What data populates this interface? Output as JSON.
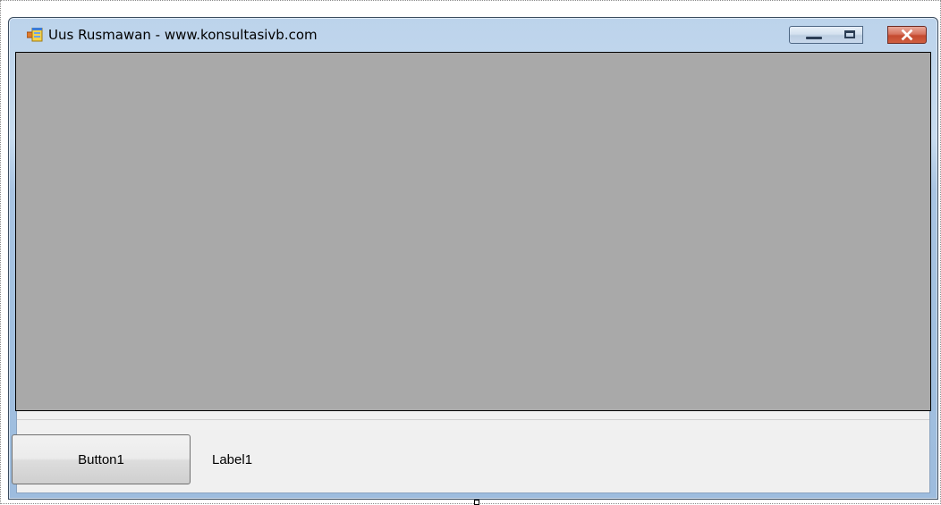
{
  "window": {
    "title": "Uus Rusmawan - www.konsultasivb.com",
    "caption_buttons": [
      "minimize",
      "maximize",
      "close"
    ]
  },
  "panel": {
    "background_color": "#A9A9A9"
  },
  "bottom": {
    "button_label": "Button1",
    "label_text": "Label1"
  },
  "icons": {
    "app": "app-form-icon",
    "minimize": "minimize-icon",
    "maximize": "maximize-icon",
    "close": "close-icon"
  }
}
